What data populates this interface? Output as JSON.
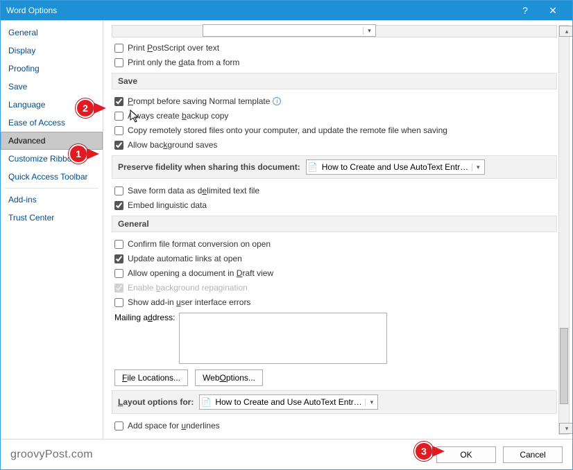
{
  "title": "Word Options",
  "sidebar": {
    "items": [
      {
        "label": "General"
      },
      {
        "label": "Display"
      },
      {
        "label": "Proofing"
      },
      {
        "label": "Save"
      },
      {
        "label": "Language"
      },
      {
        "label": "Ease of Access"
      },
      {
        "label": "Advanced",
        "selected": true
      },
      {
        "label": "Customize Ribbon"
      },
      {
        "label": "Quick Access Toolbar"
      },
      {
        "label": "Add-ins"
      },
      {
        "label": "Trust Center"
      }
    ]
  },
  "top_options": {
    "postscript": "Print PostScript over text",
    "print_data_form": "Print only the data from a form"
  },
  "save_section": {
    "header": "Save",
    "prompt_normal": "Prompt before saving Normal template",
    "backup": "Always create backup copy",
    "copy_remote": "Copy remotely stored files onto your computer, and update the remote file when saving",
    "bg_saves": "Allow background saves"
  },
  "fidelity": {
    "label": "Preserve fidelity when sharing this document:",
    "selected": "How to Create and Use AutoText Entrie..."
  },
  "fidelity_options": {
    "save_form_data": "Save form data as delimited text file",
    "embed_linguistic": "Embed linguistic data"
  },
  "general_section": {
    "header": "General",
    "confirm_file_format": "Confirm file format conversion on open",
    "update_links": "Update automatic links at open",
    "allow_draft": "Allow opening a document in Draft view",
    "enable_repag": "Enable background repagination",
    "show_addin_errors": "Show add-in user interface errors",
    "mailing_label": "Mailing address:"
  },
  "buttons": {
    "file_locations": "File Locations...",
    "web_options": "Web Options..."
  },
  "layout_options": {
    "label": "Layout options for:",
    "selected": "How to Create and Use AutoText Entrie...",
    "add_space_underlines": "Add space for underlines"
  },
  "footer": {
    "ok": "OK",
    "cancel": "Cancel",
    "brand": "groovyPost.com"
  },
  "callouts": {
    "1": "1",
    "2": "2",
    "3": "3"
  }
}
